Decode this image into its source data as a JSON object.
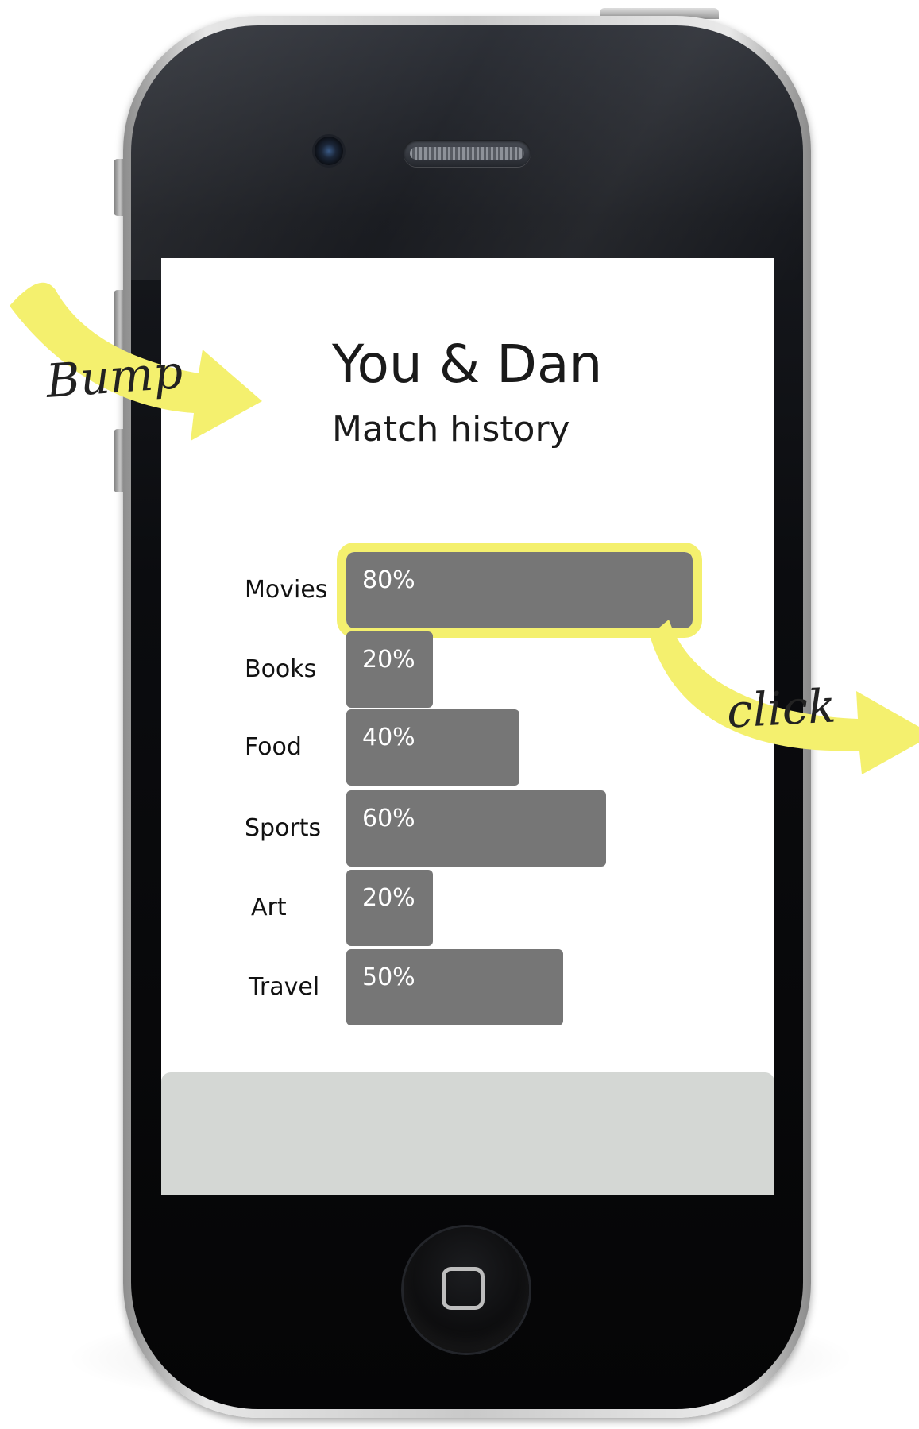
{
  "screen": {
    "title": "You & Dan",
    "subtitle": "Match history"
  },
  "match_categories": [
    {
      "label": "Movies",
      "percent_text": "80%",
      "value": 80,
      "highlighted": true
    },
    {
      "label": "Books",
      "percent_text": "20%",
      "value": 20,
      "highlighted": false
    },
    {
      "label": "Food",
      "percent_text": "40%",
      "value": 40,
      "highlighted": false
    },
    {
      "label": "Sports",
      "percent_text": "60%",
      "value": 60,
      "highlighted": false
    },
    {
      "label": "Art",
      "percent_text": "20%",
      "value": 20,
      "highlighted": false
    },
    {
      "label": "Travel",
      "percent_text": "50%",
      "value": 50,
      "highlighted": false
    }
  ],
  "annotations": {
    "bump": "Bump",
    "click": "click"
  },
  "colors": {
    "accent": "#f4f06e",
    "bar": "#767676",
    "footer": "#d4d7d4"
  },
  "icons": {
    "home": "home-button-icon",
    "camera": "front-camera-icon",
    "speaker": "earpiece-speaker-icon"
  }
}
